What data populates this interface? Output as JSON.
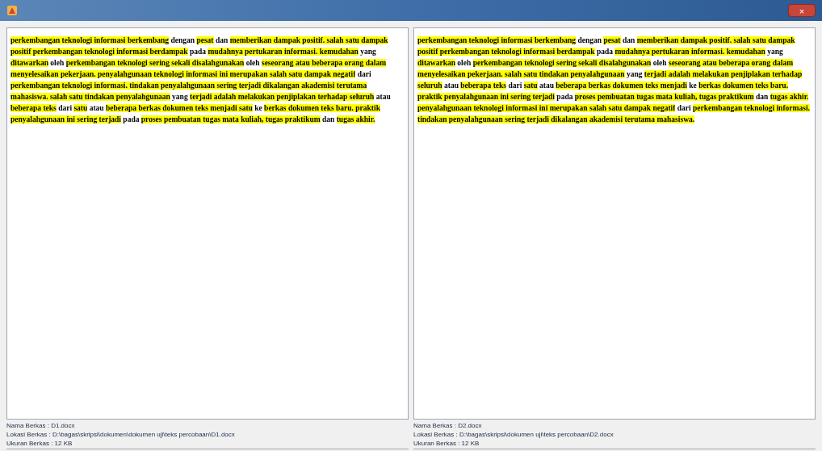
{
  "window": {
    "close_label": "×"
  },
  "panes": [
    {
      "segments": [
        {
          "text": "perkembangan teknologi informasi berkembang",
          "highlighted": true
        },
        {
          "text": " dengan ",
          "highlighted": false
        },
        {
          "text": "pesat",
          "highlighted": true
        },
        {
          "text": " dan ",
          "highlighted": false
        },
        {
          "text": "memberikan dampak positif. salah satu dampak positif perkembangan teknologi informasi berdampak",
          "highlighted": true
        },
        {
          "text": " pada ",
          "highlighted": false
        },
        {
          "text": "mudahnya pertukaran informasi. kemudahan",
          "highlighted": true
        },
        {
          "text": " yang ",
          "highlighted": false
        },
        {
          "text": "ditawarkan",
          "highlighted": true
        },
        {
          "text": " oleh ",
          "highlighted": false
        },
        {
          "text": "perkembangan teknologi sering sekali disalahgunakan",
          "highlighted": true
        },
        {
          "text": " oleh ",
          "highlighted": false
        },
        {
          "text": "seseorang atau beberapa orang dalam menyelesaikan pekerjaan. penyalahgunaan teknologi informasi ini merupakan salah satu dampak negatif",
          "highlighted": true
        },
        {
          "text": " dari ",
          "highlighted": false
        },
        {
          "text": "perkembangan teknologi informasi. tindakan penyalahgunaan sering terjadi dikalangan akademisi terutama mahasiswa. salah satu tindakan penyalahgunaan",
          "highlighted": true
        },
        {
          "text": " yang ",
          "highlighted": false
        },
        {
          "text": "terjadi adalah melakukan penjiplakan terhadap seluruh",
          "highlighted": true
        },
        {
          "text": " atau ",
          "highlighted": false
        },
        {
          "text": "beberapa teks",
          "highlighted": true
        },
        {
          "text": " dari ",
          "highlighted": false
        },
        {
          "text": "satu",
          "highlighted": true
        },
        {
          "text": " atau ",
          "highlighted": false
        },
        {
          "text": "beberapa berkas dokumen teks menjadi satu",
          "highlighted": true
        },
        {
          "text": " ke ",
          "highlighted": false
        },
        {
          "text": "berkas dokumen teks baru. praktik penyalahgunaan ini sering terjadi",
          "highlighted": true
        },
        {
          "text": " pada ",
          "highlighted": false
        },
        {
          "text": "proses pembuatan tugas mata kuliah, tugas praktikum",
          "highlighted": true
        },
        {
          "text": " dan ",
          "highlighted": false
        },
        {
          "text": "tugas akhir.",
          "highlighted": true
        }
      ],
      "file_name": "Nama Berkas : D1.docx",
      "file_location": "Lokasi Berkas : D:\\bagas\\skripsi\\dokumen\\dokumen uji\\teks percobaan\\D1.docx",
      "file_size": "Ukuran Berkas : 12 KB"
    },
    {
      "segments": [
        {
          "text": "perkembangan teknologi informasi berkembang",
          "highlighted": true
        },
        {
          "text": " dengan ",
          "highlighted": false
        },
        {
          "text": "pesat",
          "highlighted": true
        },
        {
          "text": " dan ",
          "highlighted": false
        },
        {
          "text": "memberikan dampak positif. salah satu dampak positif perkembangan teknologi informasi berdampak",
          "highlighted": true
        },
        {
          "text": " pada ",
          "highlighted": false
        },
        {
          "text": "mudahnya pertukaran informasi. kemudahan",
          "highlighted": true
        },
        {
          "text": " yang ",
          "highlighted": false
        },
        {
          "text": "ditawarkan",
          "highlighted": true
        },
        {
          "text": " oleh ",
          "highlighted": false
        },
        {
          "text": "perkembangan teknologi sering sekali disalahgunakan",
          "highlighted": true
        },
        {
          "text": " oleh ",
          "highlighted": false
        },
        {
          "text": "seseorang atau beberapa orang dalam menyelesaikan pekerjaan. salah satu tindakan penyalahgunaan",
          "highlighted": true
        },
        {
          "text": " yang ",
          "highlighted": false
        },
        {
          "text": "terjadi adalah melakukan penjiplakan terhadap seluruh",
          "highlighted": true
        },
        {
          "text": " atau ",
          "highlighted": false
        },
        {
          "text": "beberapa teks",
          "highlighted": true
        },
        {
          "text": " dari ",
          "highlighted": false
        },
        {
          "text": "satu",
          "highlighted": true
        },
        {
          "text": " atau ",
          "highlighted": false
        },
        {
          "text": "beberapa berkas dokumen teks menjadi",
          "highlighted": true
        },
        {
          "text": " ke ",
          "highlighted": false
        },
        {
          "text": "berkas dokumen teks baru. praktik penyalahgunaan ini sering terjadi",
          "highlighted": true
        },
        {
          "text": " pada ",
          "highlighted": false
        },
        {
          "text": "proses pembuatan tugas mata kuliah, tugas praktikum",
          "highlighted": true
        },
        {
          "text": " dan ",
          "highlighted": false
        },
        {
          "text": "tugas akhir. penyalahgunaan teknologi informasi ini merupakan salah satu dampak negatif",
          "highlighted": true
        },
        {
          "text": " dari ",
          "highlighted": false
        },
        {
          "text": "perkembangan teknologi informasi. tindakan penyalahgunaan sering terjadi dikalangan akademisi terutama mahasiswa.",
          "highlighted": true
        }
      ],
      "file_name": "Nama Berkas : D2.docx",
      "file_location": "Lokasi Berkas : D:\\bagas\\skripsi\\dokumen uji\\teks percobaan\\D2.docx",
      "file_size": "Ukuran Berkas : 12 KB"
    }
  ]
}
